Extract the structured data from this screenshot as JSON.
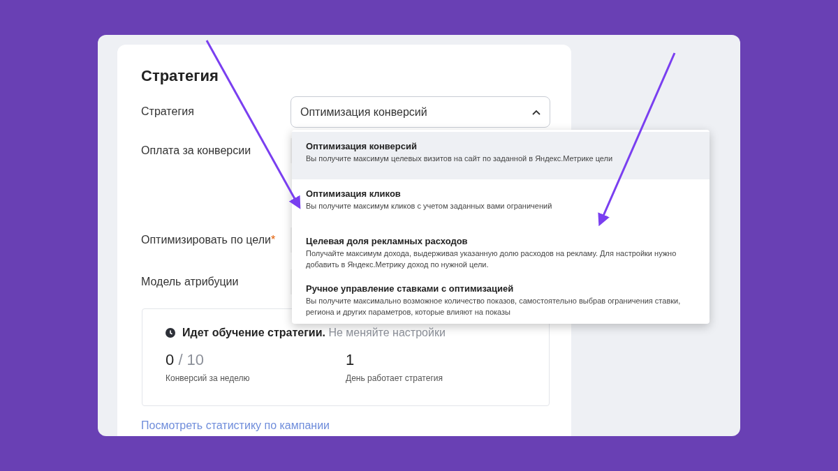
{
  "heading": "Стратегия",
  "fields": [
    {
      "label": "Стратегия"
    },
    {
      "label": "Оплата за конверсии"
    },
    {
      "label": "Оптимизировать по цели",
      "required_mark": "*"
    },
    {
      "label": "Модель атрибуции"
    }
  ],
  "select": {
    "value": "Оптимизация конверсий",
    "expanded": true
  },
  "dropdown": [
    {
      "title": "Оптимизация конверсий",
      "description": "Вы получите максимум целевых визитов на сайт по заданной в Яндекс.Метрике цели",
      "selected": true
    },
    {
      "title": "Оптимизация кликов",
      "description": "Вы получите максимум кликов с учетом заданных вами ограничений",
      "selected": false
    },
    {
      "title": "Целевая доля рекламных расходов",
      "description": "Получайте максимум дохода, выдерживая указанную долю расходов на рекламу. Для настройки нужно добавить в Яндекс.Метрику доход по нужной цели.",
      "selected": false
    },
    {
      "title": "Ручное управление ставками с оптимизацией",
      "description": "Вы получите максимально возможное количество показов, самостоятельно выбрав ограничения ставки, региона и других параметров, которые влияют на показы",
      "selected": false
    }
  ],
  "learning": {
    "title": "Идет обучение стратегии.",
    "hint": "Не меняйте настройки",
    "stats": [
      {
        "value": "0",
        "total": "/ 10",
        "caption": "Конверсий за неделю"
      },
      {
        "value": "1",
        "caption": "День работает стратегия"
      }
    ]
  },
  "link": "Посмотреть статистику по кампании"
}
